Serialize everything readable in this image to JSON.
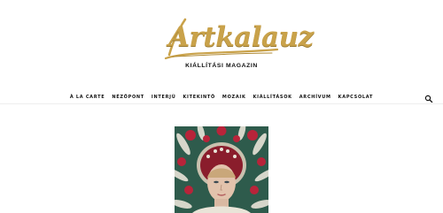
{
  "brand": {
    "logo_text": "Artkalauz",
    "tagline": "KIÁLLÍTÁSI MAGAZIN",
    "logo_color": "#c9a24a"
  },
  "nav": {
    "items": [
      {
        "label": "À LA CARTE"
      },
      {
        "label": "NÉZŐPONT"
      },
      {
        "label": "INTERJÚ"
      },
      {
        "label": "KITEKINTŐ"
      },
      {
        "label": "MOZAIK"
      },
      {
        "label": "KIÁLLÍTÁSOK"
      },
      {
        "label": "ARCHÍVUM"
      },
      {
        "label": "KAPCSOLAT"
      }
    ],
    "search_icon": "search-icon"
  },
  "featured": {
    "icon": "portrait-image",
    "background_color": "#2e5b4c",
    "accent_color": "#b8243a"
  }
}
